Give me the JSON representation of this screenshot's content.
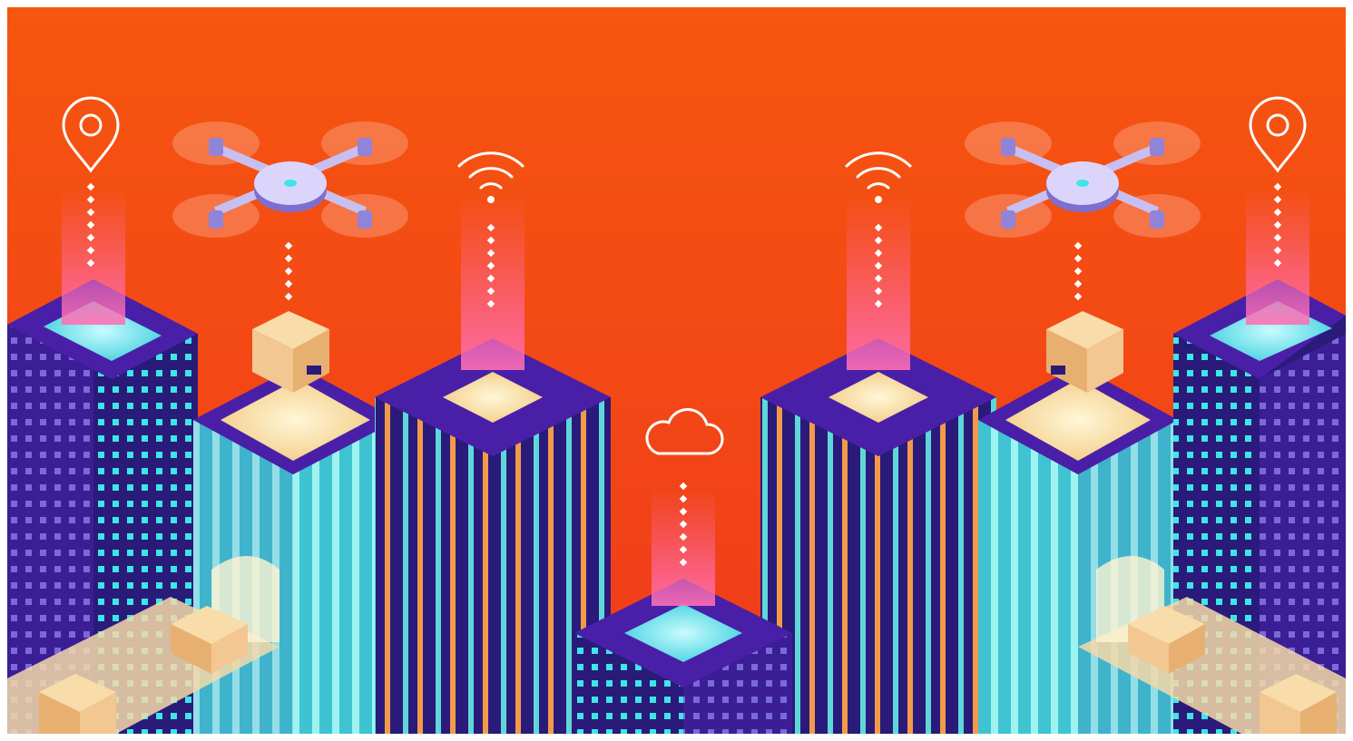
{
  "colors": {
    "sky_top": "#f6560f",
    "sky_bottom": "#f03a1c",
    "tower_dark": "#2a1a7a",
    "tower_mid": "#4a1fa8",
    "tower_light": "#6a36d6",
    "window_cyan": "#3ee6e6",
    "glass_stripe": "#5fd7d9",
    "stripe_orange": "#f29a4a",
    "beam_pink": "#ff6fb4",
    "box_tan": "#f2c791",
    "drone_body": "#c8bff0",
    "icon_white": "#ffffff"
  },
  "icons": {
    "left_pin": "location-pin-icon",
    "left_wifi": "wifi-icon",
    "cloud": "cloud-icon",
    "right_wifi": "wifi-icon",
    "right_pin": "location-pin-icon"
  },
  "scene": {
    "drones": 2,
    "towers": 7,
    "packages": 6
  }
}
